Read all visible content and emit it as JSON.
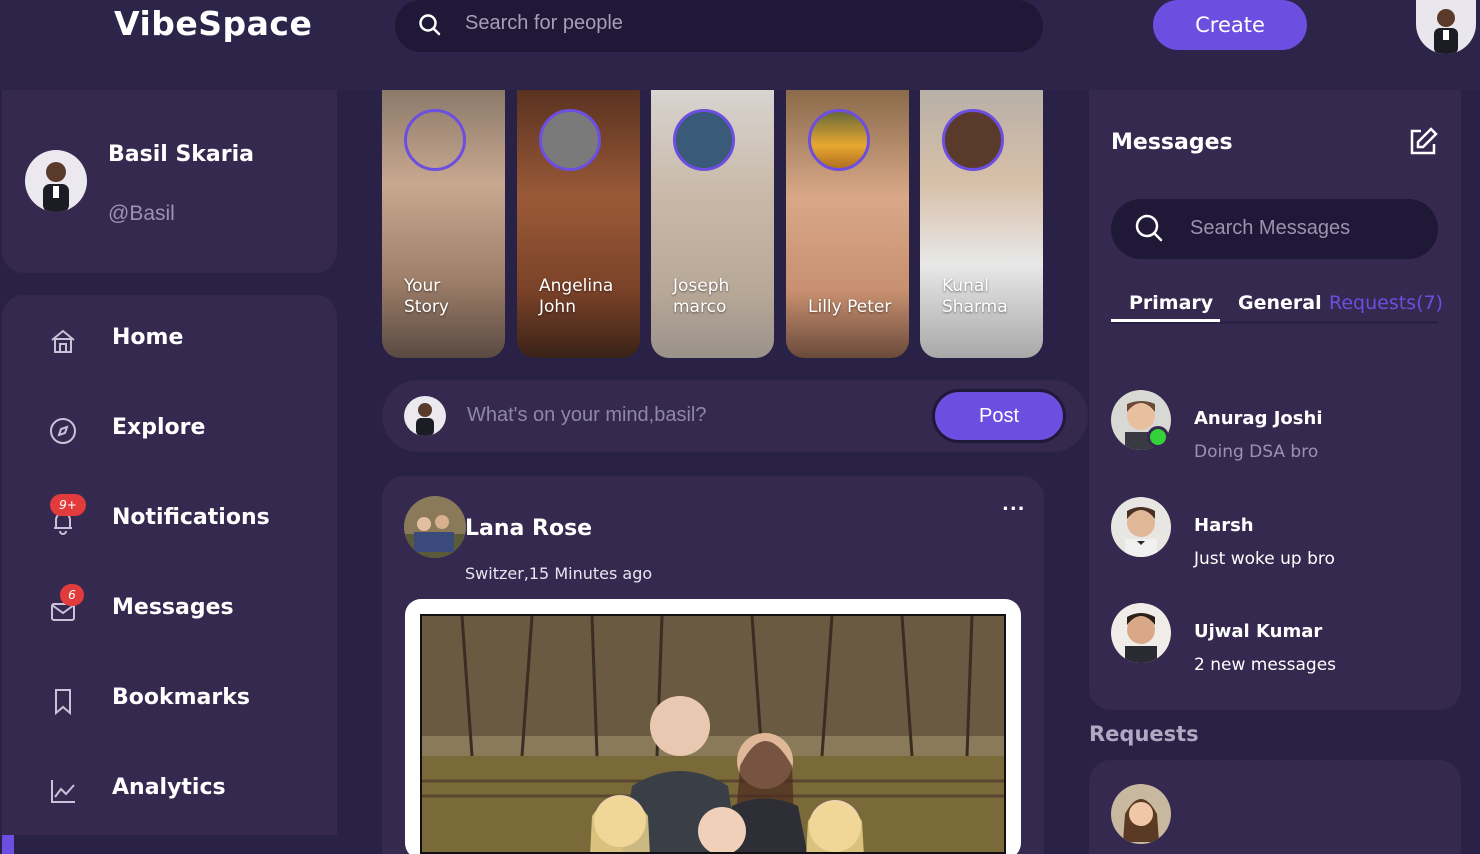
{
  "app": {
    "logo": "VibeSpace"
  },
  "header": {
    "search_placeholder": "Search for people",
    "create_label": "Create"
  },
  "profile": {
    "name": "Basil Skaria",
    "handle": "@Basil"
  },
  "nav": [
    {
      "label": "Home",
      "icon": "home-icon"
    },
    {
      "label": "Explore",
      "icon": "compass-icon"
    },
    {
      "label": "Notifications",
      "icon": "bell-icon",
      "badge": "9+"
    },
    {
      "label": "Messages",
      "icon": "envelope-icon",
      "badge": "6"
    },
    {
      "label": "Bookmarks",
      "icon": "bookmark-icon"
    },
    {
      "label": "Analytics",
      "icon": "chart-icon"
    }
  ],
  "stories": [
    {
      "name": "Your Story"
    },
    {
      "name": "Angelina John"
    },
    {
      "name": "Joseph marco"
    },
    {
      "name": "Lilly Peter"
    },
    {
      "name": "Kunal Sharma"
    }
  ],
  "composer": {
    "placeholder": "What's on your mind,basil?",
    "post_label": "Post"
  },
  "feed": {
    "author": "Lana Rose",
    "meta": "Switzer,15 Minutes ago",
    "more": "..."
  },
  "messages": {
    "title": "Messages",
    "search_placeholder": "Search Messages",
    "tabs": {
      "primary": "Primary",
      "general": "General",
      "requests": "Requests(7)"
    },
    "conversations": [
      {
        "name": "Anurag Joshi",
        "preview": "Doing DSA bro",
        "online": true
      },
      {
        "name": "Harsh",
        "preview": "Just woke up bro",
        "online": false
      },
      {
        "name": "Ujwal Kumar",
        "preview": "2 new messages",
        "online": false
      }
    ]
  },
  "requests": {
    "title": "Requests"
  },
  "colors": {
    "accent": "#6c4ee0",
    "background": "#2a2146",
    "card": "#35294f",
    "badge": "#e23b3b",
    "online": "#34d13a"
  }
}
